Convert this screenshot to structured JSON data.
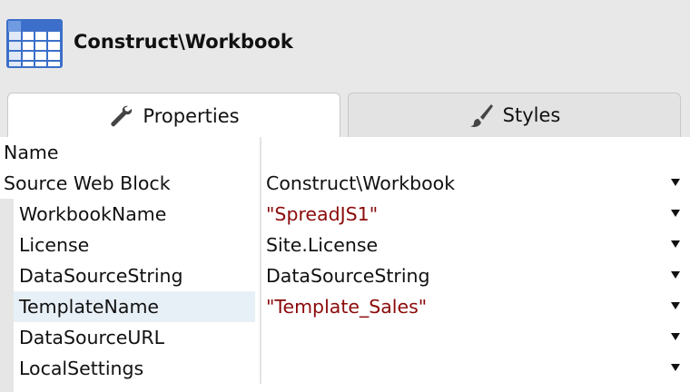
{
  "header": {
    "title": "Construct\\Workbook",
    "icon": "spreadsheet-grid-icon"
  },
  "tabs": [
    {
      "label": "Properties",
      "icon": "wrench-icon",
      "active": true
    },
    {
      "label": "Styles",
      "icon": "paintbrush-icon",
      "active": false
    }
  ],
  "properties": [
    {
      "name": "Name",
      "value": "",
      "type": "text",
      "dropdown": false
    },
    {
      "name": "Source Web Block",
      "value": "Construct\\Workbook",
      "type": "reference",
      "dropdown": true
    },
    {
      "name": "WorkbookName",
      "value": "\"SpreadJS1\"",
      "type": "string",
      "dropdown": true
    },
    {
      "name": "License",
      "value": "Site.License",
      "type": "reference",
      "dropdown": true
    },
    {
      "name": "DataSourceString",
      "value": "DataSourceString",
      "type": "reference",
      "dropdown": true
    },
    {
      "name": "TemplateName",
      "value": "\"Template_Sales\"",
      "type": "string",
      "dropdown": true,
      "highlighted": true
    },
    {
      "name": "DataSourceURL",
      "value": "",
      "type": "reference",
      "dropdown": true
    },
    {
      "name": "LocalSettings",
      "value": "",
      "type": "reference",
      "dropdown": true
    }
  ],
  "colors": {
    "string_value": "#8b0a0a",
    "icon_blue": "#3b6fc9",
    "background": "#e8e8e8"
  }
}
